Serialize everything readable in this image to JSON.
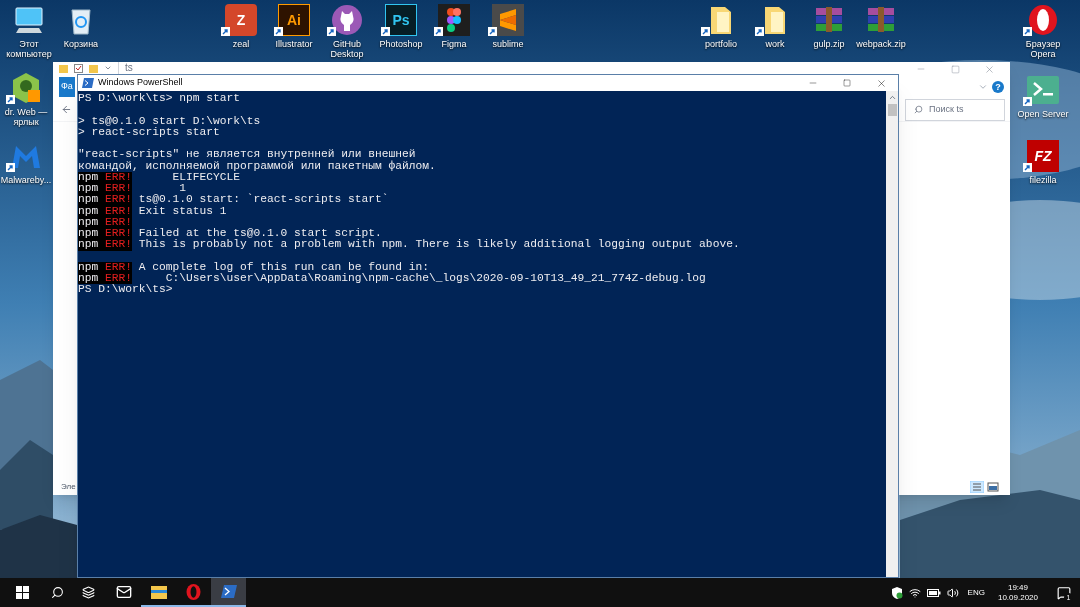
{
  "desktop_icons": [
    {
      "kind": "computer",
      "label": "Этот компьютер",
      "shortcut": false
    },
    {
      "kind": "recycle",
      "label": "Корзина",
      "shortcut": false
    },
    {
      "kind": "zeal",
      "label": "zeal",
      "glyph": "Z",
      "shortcut": true
    },
    {
      "kind": "illustrator",
      "label": "Illustrator",
      "glyph": "Ai",
      "shortcut": true
    },
    {
      "kind": "github",
      "label": "GitHub Desktop",
      "shortcut": true
    },
    {
      "kind": "photoshop",
      "label": "Photoshop",
      "glyph": "Ps",
      "shortcut": true
    },
    {
      "kind": "figma",
      "label": "Figma",
      "shortcut": true
    },
    {
      "kind": "sublime",
      "label": "sublime",
      "shortcut": true
    },
    {
      "kind": "folder",
      "label": "portfolio",
      "shortcut": true
    },
    {
      "kind": "folder",
      "label": "work",
      "shortcut": true
    },
    {
      "kind": "archive",
      "label": "gulp.zip",
      "shortcut": false
    },
    {
      "kind": "archive",
      "label": "webpack.zip",
      "shortcut": false
    },
    {
      "kind": "opera",
      "label": "Браузер Opera",
      "shortcut": true
    },
    {
      "kind": "drweb",
      "label": "dr. Web — ярлык",
      "shortcut": true
    },
    {
      "kind": "malwarebytes",
      "label": "Malwareby...",
      "shortcut": true
    },
    {
      "kind": "openserver",
      "label": "Open Server",
      "shortcut": true
    },
    {
      "kind": "filezilla",
      "label": "filezilla",
      "glyph": "FZ",
      "shortcut": true
    }
  ],
  "explorer": {
    "title": "ts",
    "ribbon_tab": "Фа",
    "help": "?",
    "search": {
      "placeholder": "Поиск ts"
    },
    "status": "Эле"
  },
  "powershell": {
    "title": "Windows PowerShell",
    "lines": [
      {
        "kind": "plain",
        "text": "PS D:\\work\\ts> npm start"
      },
      {
        "kind": "blank"
      },
      {
        "kind": "plain",
        "text": "> ts@0.1.0 start D:\\work\\ts"
      },
      {
        "kind": "plain",
        "text": "> react-scripts start"
      },
      {
        "kind": "blank"
      },
      {
        "kind": "plain",
        "text": "\"react-scripts\" не является внутренней или внешней"
      },
      {
        "kind": "plain",
        "text": "командой, исполняемой программой или пакетным файлом."
      },
      {
        "kind": "err",
        "prefix": "npm",
        "tag": "ERR!",
        "text": "      ELIFECYCLE"
      },
      {
        "kind": "err",
        "prefix": "npm",
        "tag": "ERR!",
        "text": "       1"
      },
      {
        "kind": "err",
        "prefix": "npm",
        "tag": "ERR!",
        "text": " ts@0.1.0 start: `react-scripts start`"
      },
      {
        "kind": "err",
        "prefix": "npm",
        "tag": "ERR!",
        "text": " Exit status 1"
      },
      {
        "kind": "err",
        "prefix": "npm",
        "tag": "ERR!"
      },
      {
        "kind": "err",
        "prefix": "npm",
        "tag": "ERR!",
        "text": " Failed at the ts@0.1.0 start script."
      },
      {
        "kind": "err",
        "prefix": "npm",
        "tag": "ERR!",
        "text": " This is probably not a problem with npm. There is likely additional logging output above."
      },
      {
        "kind": "blank"
      },
      {
        "kind": "err",
        "prefix": "npm",
        "tag": "ERR!",
        "text": " A complete log of this run can be found in:"
      },
      {
        "kind": "err",
        "prefix": "npm",
        "tag": "ERR!",
        "text": "     C:\\Users\\user\\AppData\\Roaming\\npm-cache\\_logs\\2020-09-10T13_49_21_774Z-debug.log"
      },
      {
        "kind": "plain",
        "text": "PS D:\\work\\ts>"
      }
    ]
  },
  "taskbar": {
    "apps": [
      {
        "kind": "mail",
        "running": false,
        "selected": false
      },
      {
        "kind": "explorer",
        "running": true,
        "selected": false
      },
      {
        "kind": "opera",
        "running": true,
        "selected": false
      },
      {
        "kind": "powershell",
        "running": true,
        "selected": true
      }
    ],
    "language": "ENG",
    "time": "19:49",
    "date": "10.09.2020",
    "notifications": "1"
  }
}
